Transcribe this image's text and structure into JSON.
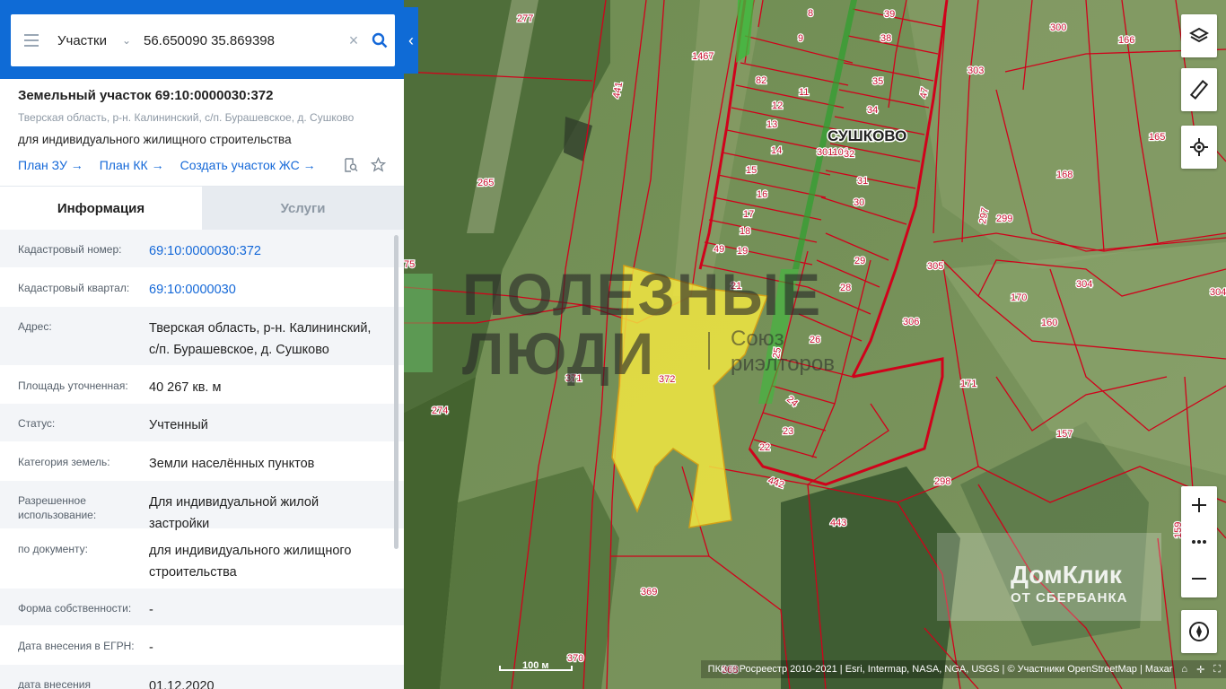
{
  "search": {
    "type_label": "Участки",
    "query": "56.650090 35.869398"
  },
  "plot": {
    "title": "Земельный участок 69:10:0000030:372",
    "address_short": "Тверская область, р-н. Калининский, с/п. Бурашевское, д. Сушково",
    "purpose": "для индивидуального жилищного строительства",
    "links": [
      "План ЗУ →",
      "План КК →",
      "Создать участок ЖС →"
    ]
  },
  "tabs": {
    "info": "Информация",
    "services": "Услуги"
  },
  "info_rows": [
    {
      "label": "Кадастровый номер:",
      "value": "69:10:0000030:372"
    },
    {
      "label": "Кадастровый квартал:",
      "value": "69:10:0000030"
    },
    {
      "label": "Адрес:",
      "value": "Тверская область, р-н. Калининский, с/п. Бурашевское, д. Сушково"
    },
    {
      "label": "Площадь уточненная:",
      "value": "40 267 кв. м"
    },
    {
      "label": "Статус:",
      "value": "Учтенный"
    },
    {
      "label": "Категория земель:",
      "value": "Земли населённых пунктов"
    },
    {
      "label": "Разрешенное использование:",
      "value": "Для индивидуальной жилой застройки"
    },
    {
      "label": "по документу:",
      "value": "для индивидуального жилищного строительства"
    },
    {
      "label": "Форма собственности:",
      "value": "-"
    },
    {
      "label": "Дата внесения в ЕГРН:",
      "value": "-"
    },
    {
      "label": "дата внесения",
      "value": "01.12.2020"
    }
  ],
  "map": {
    "village": "СУШКОВО",
    "quarter_code": "301101",
    "selected_plot": "372",
    "plot_numbers": [
      "277",
      "8",
      "39",
      "38",
      "300",
      "166",
      "1467",
      "9",
      "303",
      "441",
      "82",
      "11",
      "35",
      "47",
      "12",
      "34",
      "13",
      "165",
      "14",
      "32",
      "31",
      "15",
      "168",
      "16",
      "30",
      "265",
      "17",
      "297",
      "299",
      "18",
      "49",
      "19",
      "29",
      "305",
      "75",
      "21",
      "28",
      "304",
      "170",
      "306",
      "26",
      "160",
      "371",
      "372",
      "25",
      "274",
      "24",
      "171",
      "23",
      "157",
      "22",
      "442",
      "298",
      "443",
      "369",
      "370",
      "368",
      "159"
    ],
    "scale_label": "100 м",
    "attribution": "ПКК © Росреестр 2010-2021 | Esri, Intermap, NASA, NGA, USGS | © Участники OpenStreetMap | Махаr",
    "watermark_1_line1": "ПОЛЕЗНЫЕ",
    "watermark_1_line2": "ЛЮДИ",
    "watermark_1_sub1": "Союз",
    "watermark_1_sub2": "риэлторов",
    "watermark_2_line1": "ДомКлик",
    "watermark_2_line2": "ОТ СБЕРБАНКА",
    "colors": {
      "parcel_border": "#d0021b",
      "selected_fill": "#f2e641",
      "brand_blue": "#0f6bd6"
    }
  }
}
